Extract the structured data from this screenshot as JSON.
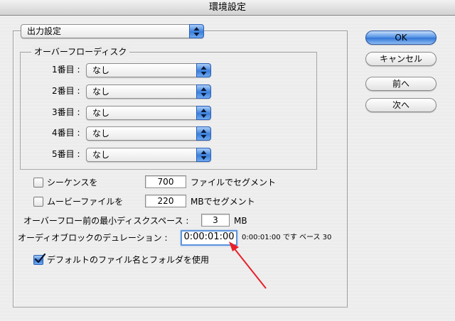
{
  "window": {
    "title": "環境設定"
  },
  "section_popup": {
    "value": "出力設定"
  },
  "overflow_group": {
    "title": "オーバーフローディスク",
    "disks": [
      {
        "label": "1番目 :",
        "value": "なし"
      },
      {
        "label": "2番目 :",
        "value": "なし"
      },
      {
        "label": "3番目 :",
        "value": "なし"
      },
      {
        "label": "4番目 :",
        "value": "なし"
      },
      {
        "label": "5番目 :",
        "value": "なし"
      }
    ]
  },
  "sequence_segment": {
    "label": "シーケンスを",
    "checked": false,
    "value": "700",
    "suffix": "ファイルでセグメント"
  },
  "movie_segment": {
    "label": "ムービーファイルを",
    "checked": false,
    "value": "220",
    "suffix": "MBでセグメント"
  },
  "min_disk_space": {
    "label": "オーバーフロー前の最小ディスクスペース :",
    "value": "3",
    "unit": "MB"
  },
  "audio_block": {
    "label": "オーディオブロックのデュレーション :",
    "value": "0:00:01:00",
    "note": "0:00:01:00 です ベース 30"
  },
  "default_names": {
    "label": "デフォルトのファイル名とフォルダを使用",
    "checked": true
  },
  "buttons": {
    "ok": "OK",
    "cancel": "キャンセル",
    "prev": "前へ",
    "next": "次へ"
  },
  "colors": {
    "accent": "#3a7fdc",
    "annotation_arrow": "#e8202a"
  },
  "icons": {
    "popup_arrows": "up-down-arrows-icon",
    "check": "checkmark-icon",
    "annotation": "red-arrow-icon"
  }
}
